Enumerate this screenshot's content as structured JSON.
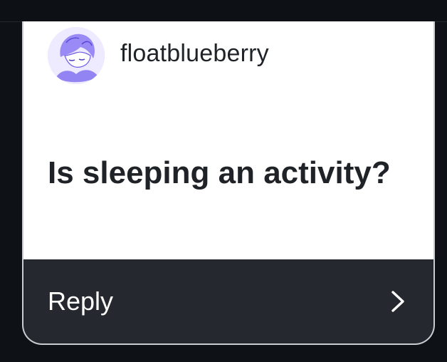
{
  "post": {
    "username": "floatblueberry",
    "question": "Is sleeping an activity?",
    "avatar_icon": "anime-avatar-icon"
  },
  "actions": {
    "reply_label": "Reply",
    "reply_icon": "chevron-right-icon"
  },
  "colors": {
    "page_background": "#0e1116",
    "card_top_background": "#ffffff",
    "card_bottom_background": "#25282e",
    "text_dark": "#1f2328",
    "text_light": "#ffffff",
    "avatar_tint": "#7b6cf0"
  }
}
